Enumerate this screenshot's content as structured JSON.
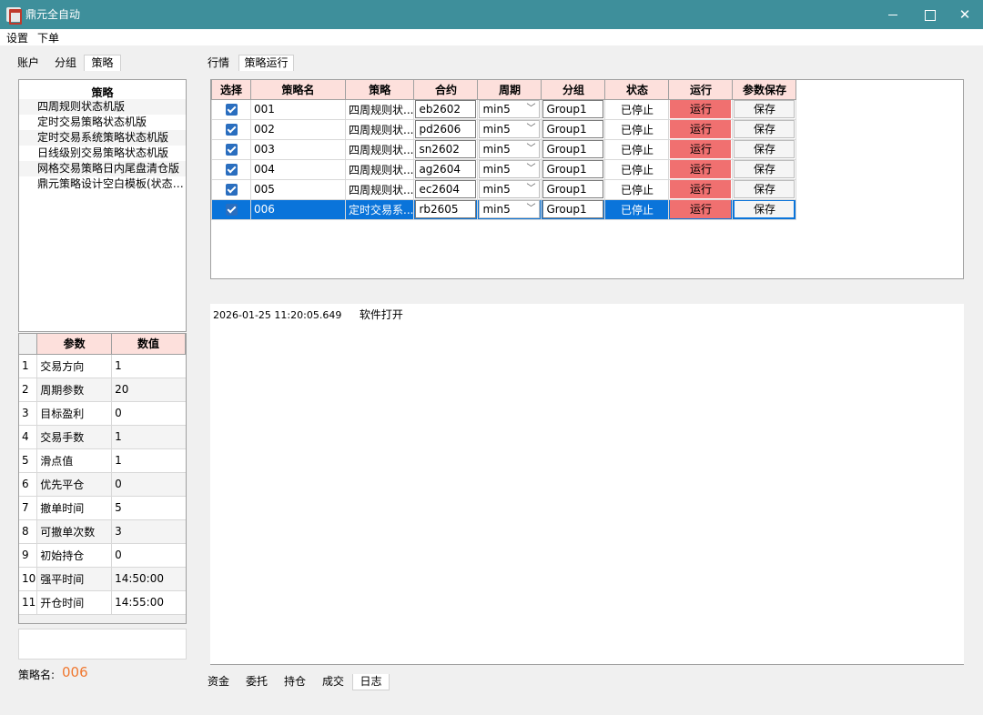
{
  "window": {
    "title": "鼎元全自动"
  },
  "menu": [
    "设置",
    "下单"
  ],
  "left_tabs": [
    "账户",
    "分组",
    "策略"
  ],
  "right_tabs": [
    "行情",
    "策略运行"
  ],
  "strategy_list": {
    "header": "策略",
    "items": [
      "四周规则状态机版",
      "定时交易策略状态机版",
      "定时交易系统策略状态机版",
      "日线级别交易策略状态机版",
      "网格交易策略日内尾盘清仓版",
      "鼎元策略设计空白模板(状态机版..."
    ]
  },
  "params": {
    "headers": [
      "参数",
      "数值"
    ],
    "rows": [
      {
        "idx": "1",
        "name": "交易方向",
        "value": "1"
      },
      {
        "idx": "2",
        "name": "周期参数",
        "value": "20"
      },
      {
        "idx": "3",
        "name": "目标盈利",
        "value": "0"
      },
      {
        "idx": "4",
        "name": "交易手数",
        "value": "1"
      },
      {
        "idx": "5",
        "name": "滑点值",
        "value": "1"
      },
      {
        "idx": "6",
        "name": "优先平仓",
        "value": "0"
      },
      {
        "idx": "7",
        "name": "撤单时间",
        "value": "5"
      },
      {
        "idx": "8",
        "name": "可撤单次数",
        "value": "3"
      },
      {
        "idx": "9",
        "name": "初始持仓",
        "value": "0"
      },
      {
        "idx": "10",
        "name": "强平时间",
        "value": "14:50:00"
      },
      {
        "idx": "11",
        "name": "开仓时间",
        "value": "14:55:00"
      }
    ]
  },
  "strategy_name": {
    "label": "策略名:",
    "value": "006"
  },
  "grid": {
    "headers": [
      "选择",
      "策略名",
      "策略",
      "合约",
      "周期",
      "分组",
      "状态",
      "运行",
      "参数保存"
    ],
    "rows": [
      {
        "name": "001",
        "strategy": "四周规则状...",
        "contract": "eb2602",
        "period": "min5",
        "group": "Group1",
        "status": "已停止",
        "run": "运行",
        "save": "保存"
      },
      {
        "name": "002",
        "strategy": "四周规则状...",
        "contract": "pd2606",
        "period": "min5",
        "group": "Group1",
        "status": "已停止",
        "run": "运行",
        "save": "保存"
      },
      {
        "name": "003",
        "strategy": "四周规则状...",
        "contract": "sn2602",
        "period": "min5",
        "group": "Group1",
        "status": "已停止",
        "run": "运行",
        "save": "保存"
      },
      {
        "name": "004",
        "strategy": "四周规则状...",
        "contract": "ag2604",
        "period": "min5",
        "group": "Group1",
        "status": "已停止",
        "run": "运行",
        "save": "保存"
      },
      {
        "name": "005",
        "strategy": "四周规则状...",
        "contract": "ec2604",
        "period": "min5",
        "group": "Group1",
        "status": "已停止",
        "run": "运行",
        "save": "保存"
      },
      {
        "name": "006",
        "strategy": "定时交易系...",
        "contract": "rb2605",
        "period": "min5",
        "group": "Group1",
        "status": "已停止",
        "run": "运行",
        "save": "保存"
      }
    ]
  },
  "log": {
    "time": "2026-01-25 11:20:05.649",
    "message": "软件打开"
  },
  "bottom_tabs": [
    "资金",
    "委托",
    "持仓",
    "成交",
    "日志"
  ],
  "colors": {
    "titlebar": "#3e8f9b",
    "header_bg": "#fde0dc",
    "run_button": "#f07070",
    "selection": "#0a74da",
    "strategy_name_value": "#f07830"
  }
}
